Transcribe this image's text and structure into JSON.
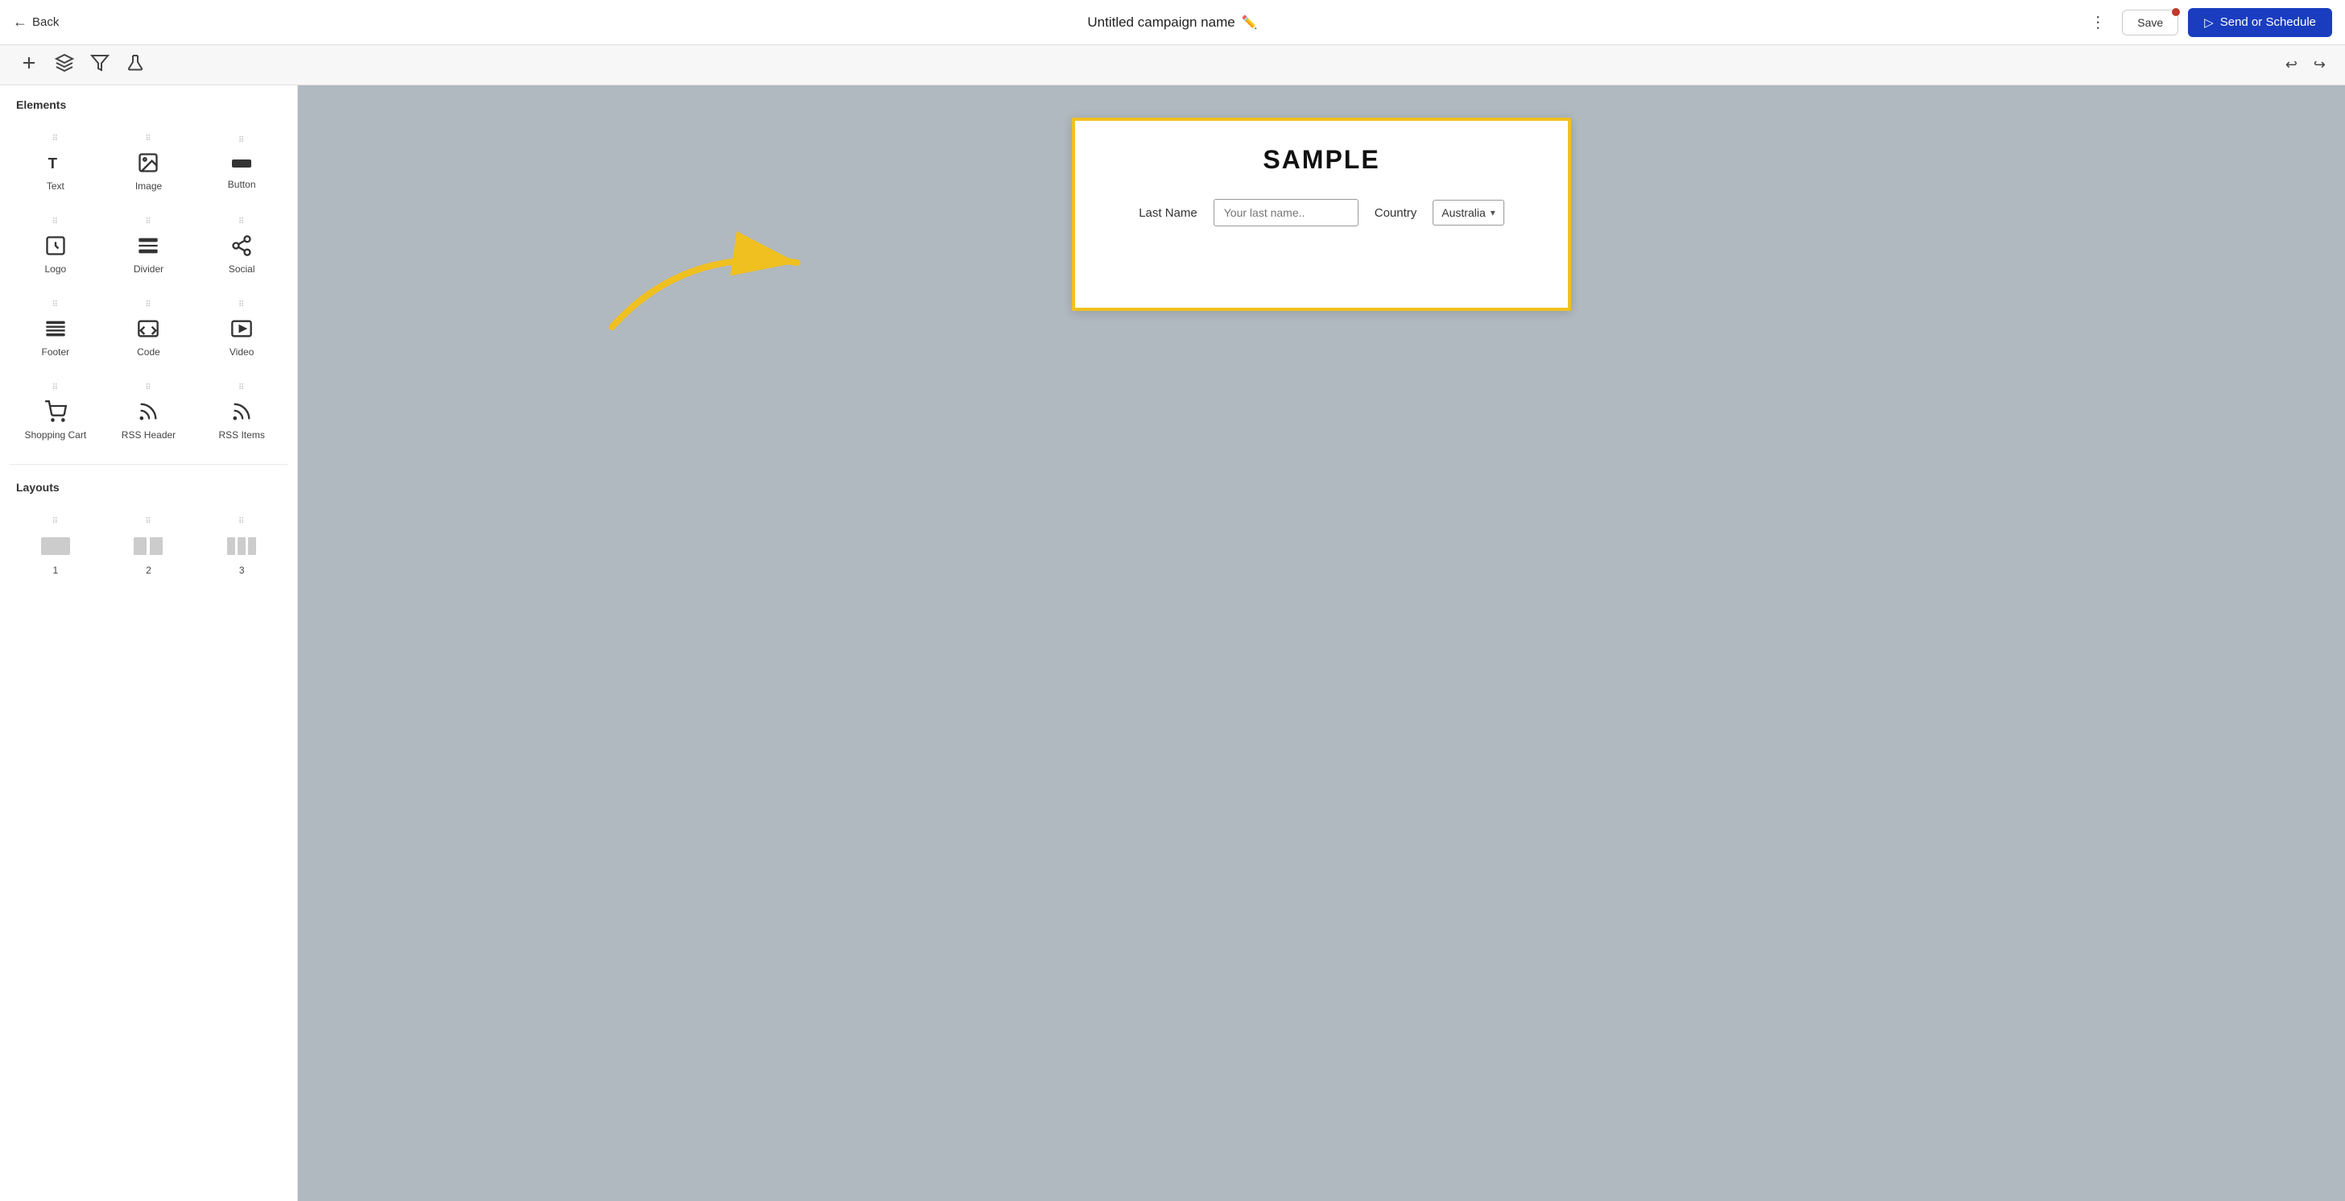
{
  "header": {
    "back_label": "Back",
    "campaign_title": "Untitled campaign name",
    "more_icon": "⋮",
    "save_label": "Save",
    "send_label": "Send or Schedule"
  },
  "toolbar": {
    "add_icon": "+",
    "layers_icon": "layers",
    "filter_icon": "filter",
    "flask_icon": "flask",
    "undo_icon": "↩",
    "redo_icon": "↪"
  },
  "sidebar": {
    "elements_title": "Elements",
    "layouts_title": "Layouts",
    "elements": [
      {
        "id": "text",
        "label": "Text"
      },
      {
        "id": "image",
        "label": "Image"
      },
      {
        "id": "button",
        "label": "Button"
      },
      {
        "id": "logo",
        "label": "Logo"
      },
      {
        "id": "divider",
        "label": "Divider"
      },
      {
        "id": "social",
        "label": "Social"
      },
      {
        "id": "footer",
        "label": "Footer"
      },
      {
        "id": "code",
        "label": "Code"
      },
      {
        "id": "video",
        "label": "Video"
      },
      {
        "id": "shopping-cart",
        "label": "Shopping Cart"
      },
      {
        "id": "rss-header",
        "label": "RSS Header"
      },
      {
        "id": "rss-items",
        "label": "RSS Items"
      }
    ],
    "layouts": [
      {
        "id": "layout-1",
        "label": "1"
      },
      {
        "id": "layout-2",
        "label": "2"
      },
      {
        "id": "layout-3",
        "label": "3"
      }
    ]
  },
  "preview": {
    "sample_title": "SAMPLE",
    "last_name_label": "Last Name",
    "last_name_placeholder": "Your last name..",
    "country_label": "Country",
    "country_value": "Australia"
  },
  "colors": {
    "send_btn_bg": "#1a3dbf",
    "arrow_color": "#f0c020",
    "highlight_border": "#f0c020",
    "notification_dot": "#c0392b"
  }
}
